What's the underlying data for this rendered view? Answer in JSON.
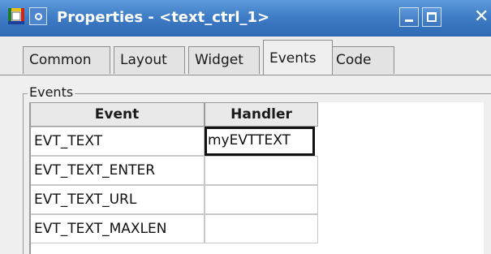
{
  "window": {
    "title": "Properties - <text_ctrl_1>",
    "accent": "#3f7dc6",
    "icons": [
      "app-icon",
      "system-menu-icon",
      "minimize-icon",
      "maximize-icon",
      "close-icon"
    ]
  },
  "tabs": [
    {
      "label": "Common",
      "active": false
    },
    {
      "label": "Layout",
      "active": false
    },
    {
      "label": "Widget",
      "active": false
    },
    {
      "label": "Events",
      "active": true
    },
    {
      "label": "Code",
      "active": false
    }
  ],
  "events_group": {
    "label": "Events",
    "columns": [
      "Event",
      "Handler"
    ],
    "rows": [
      {
        "event": "EVT_TEXT",
        "handler": "myEVTTEXT"
      },
      {
        "event": "EVT_TEXT_ENTER",
        "handler": ""
      },
      {
        "event": "EVT_TEXT_URL",
        "handler": ""
      },
      {
        "event": "EVT_TEXT_MAXLEN",
        "handler": ""
      }
    ]
  }
}
